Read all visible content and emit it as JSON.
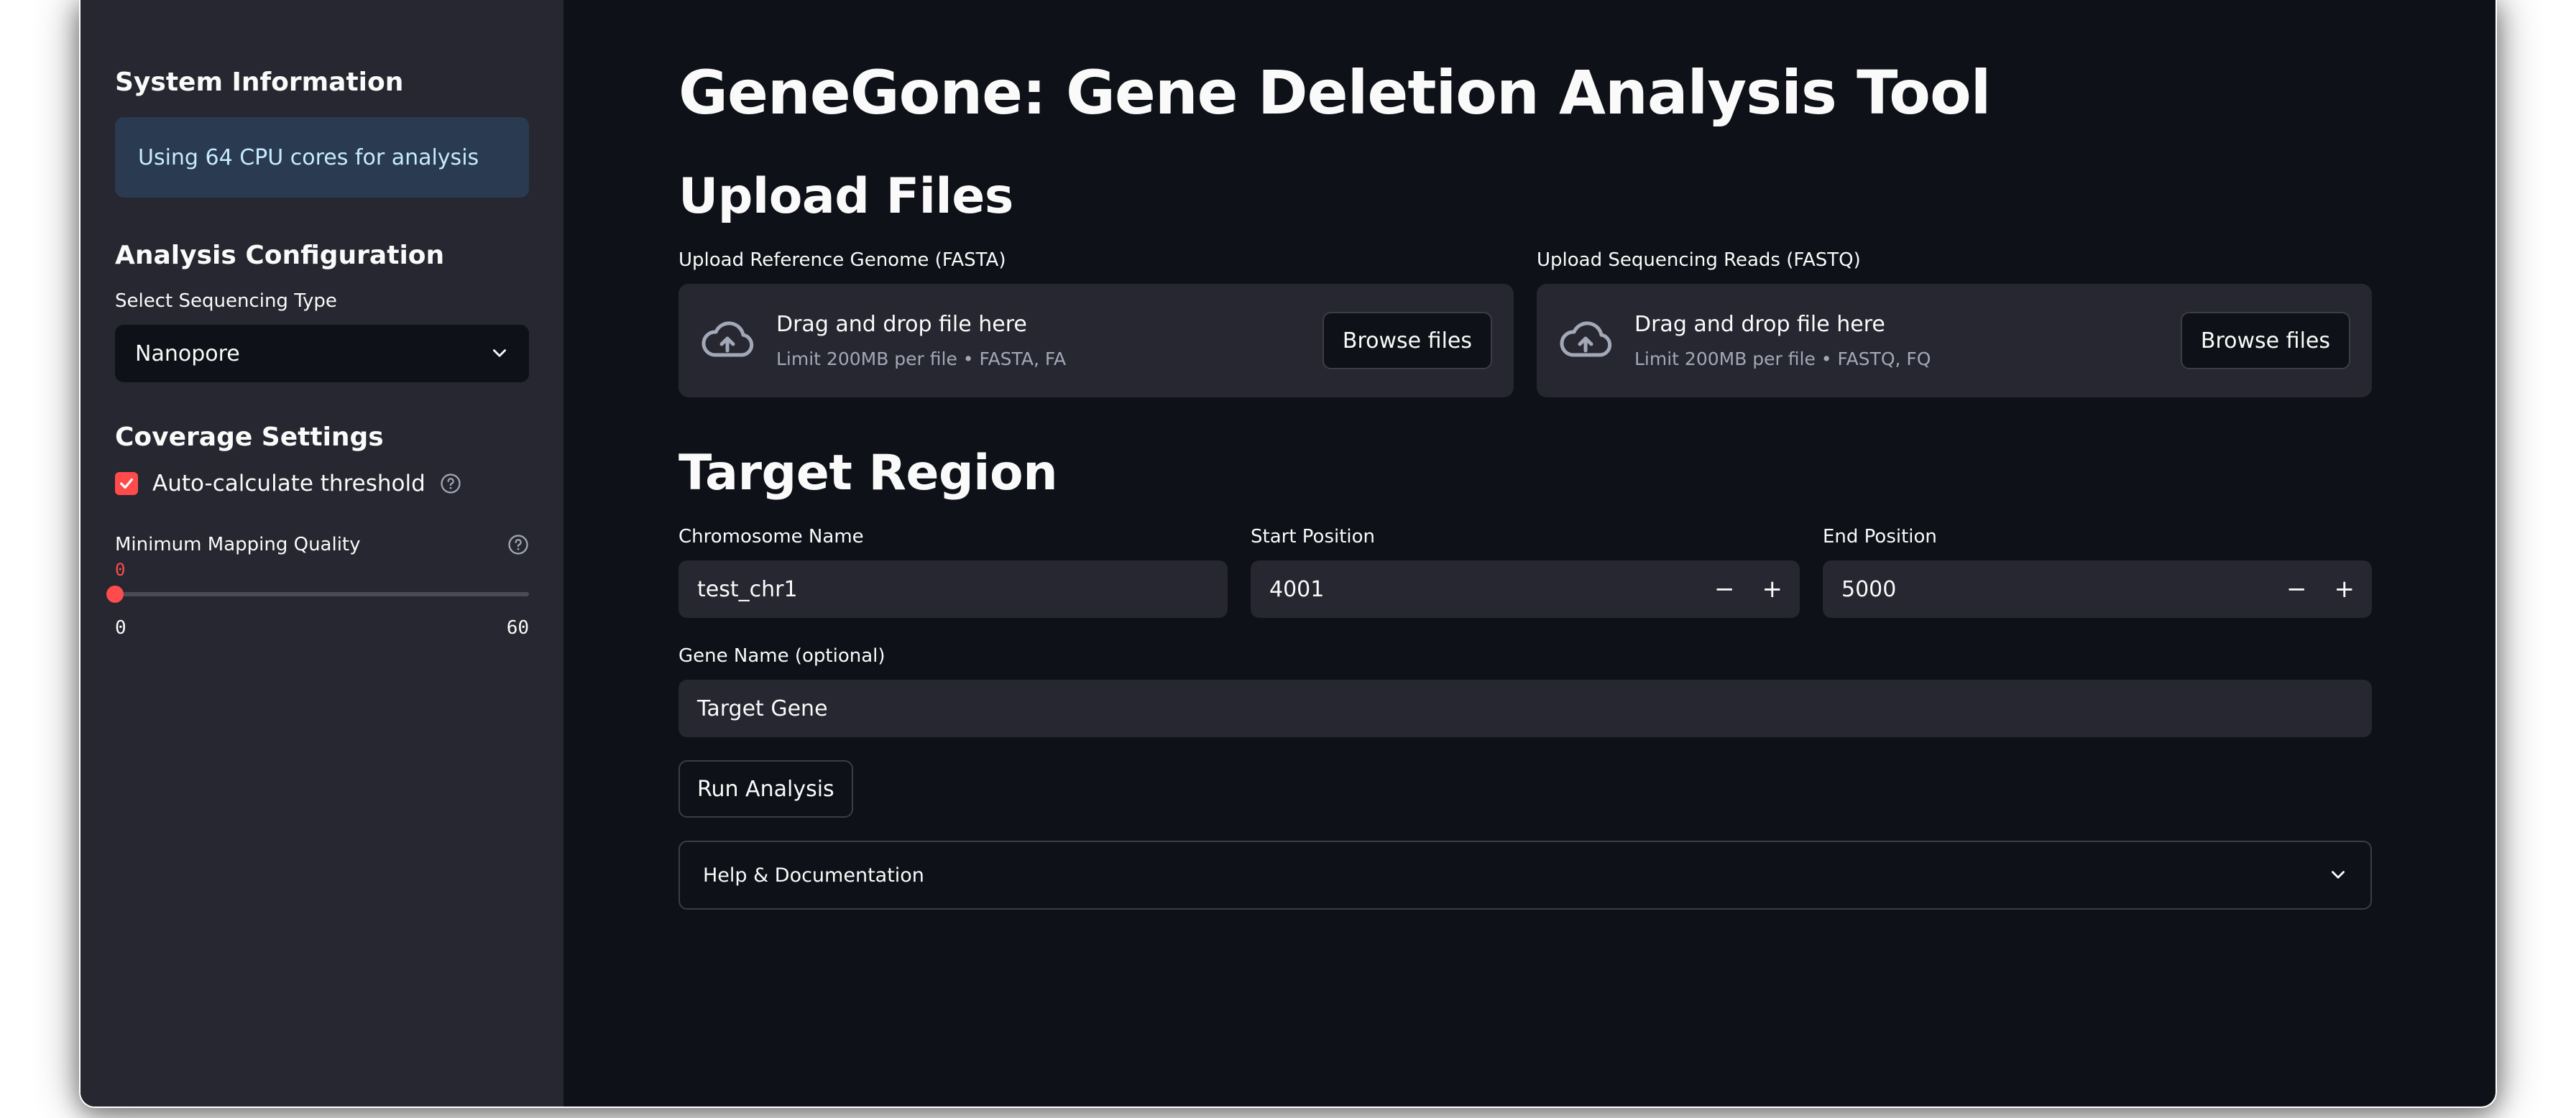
{
  "sidebar": {
    "system_heading": "System Information",
    "system_info": "Using 64 CPU cores for analysis",
    "analysis_heading": "Analysis Configuration",
    "seq_type_label": "Select Sequencing Type",
    "seq_type_value": "Nanopore",
    "coverage_heading": "Coverage Settings",
    "auto_threshold_label": "Auto-calculate threshold",
    "auto_threshold_checked": true,
    "mapq_label": "Minimum Mapping Quality",
    "mapq_value": "0",
    "mapq_min": "0",
    "mapq_max": "60"
  },
  "main": {
    "title": "GeneGone: Gene Deletion Analysis Tool",
    "upload_heading": "Upload Files",
    "ref_upload": {
      "label": "Upload Reference Genome (FASTA)",
      "drag_text": "Drag and drop file here",
      "limit_text": "Limit 200MB per file • FASTA, FA",
      "browse_label": "Browse files"
    },
    "reads_upload": {
      "label": "Upload Sequencing Reads (FASTQ)",
      "drag_text": "Drag and drop file here",
      "limit_text": "Limit 200MB per file • FASTQ, FQ",
      "browse_label": "Browse files"
    },
    "target_heading": "Target Region",
    "chrom_label": "Chromosome Name",
    "chrom_value": "test_chr1",
    "start_label": "Start Position",
    "start_value": "4001",
    "end_label": "End Position",
    "end_value": "5000",
    "minus_glyph": "−",
    "plus_glyph": "+",
    "gene_label": "Gene Name (optional)",
    "gene_value": "Target Gene",
    "run_label": "Run Analysis",
    "help_label": "Help & Documentation"
  },
  "colors": {
    "accent": "#ff4b4b",
    "background": "#0e1117",
    "sidebar": "#262730",
    "info_box": "#2a3a50"
  }
}
